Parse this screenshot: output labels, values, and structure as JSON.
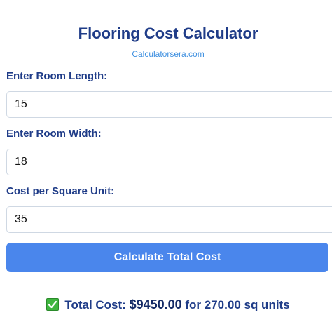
{
  "header": {
    "title": "Flooring Cost Calculator",
    "subtitle": "Calculatorsera.com"
  },
  "form": {
    "length": {
      "label": "Enter Room Length:",
      "value": "15"
    },
    "width": {
      "label": "Enter Room Width:",
      "value": "18"
    },
    "cost": {
      "label": "Cost per Square Unit:",
      "value": "35"
    },
    "button_label": "Calculate Total Cost"
  },
  "result": {
    "icon": "check-mark-icon",
    "prefix": "Total Cost:",
    "amount": "$9450.00",
    "suffix": "for 270.00 sq units"
  },
  "colors": {
    "title": "#1f3c88",
    "subtitle": "#3d8fe0",
    "button": "#4a86ec",
    "check": "#3fb53f"
  }
}
